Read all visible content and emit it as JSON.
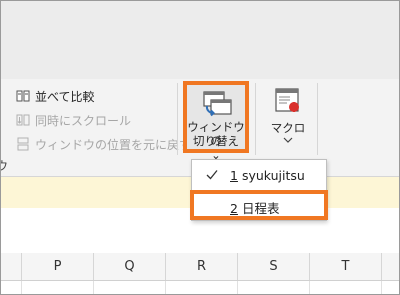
{
  "ribbon": {
    "commands": [
      {
        "label": "並べて比較",
        "enabled": true
      },
      {
        "label": "同時にスクロール",
        "enabled": false
      },
      {
        "label": "ウィンドウの位置を元に戻す",
        "enabled": false
      }
    ],
    "switch_windows": {
      "line1": "ウィンドウの",
      "line2": "切り替え",
      "chevron": "⌄"
    },
    "macro": {
      "label": "マクロ",
      "chevron": "⌄"
    }
  },
  "left_partial_char": "ウ",
  "dropdown": {
    "items": [
      {
        "number": "1",
        "name": "syukujitsu",
        "checked": true
      },
      {
        "number": "2",
        "name": "日程表",
        "checked": false
      }
    ]
  },
  "columns": [
    "P",
    "Q",
    "R",
    "S",
    "T"
  ],
  "colors": {
    "highlight": "#f07722",
    "ribbon": "#f3f3f3",
    "message_bar": "#fdf6d6",
    "icon_blue": "#2f6fb7"
  }
}
